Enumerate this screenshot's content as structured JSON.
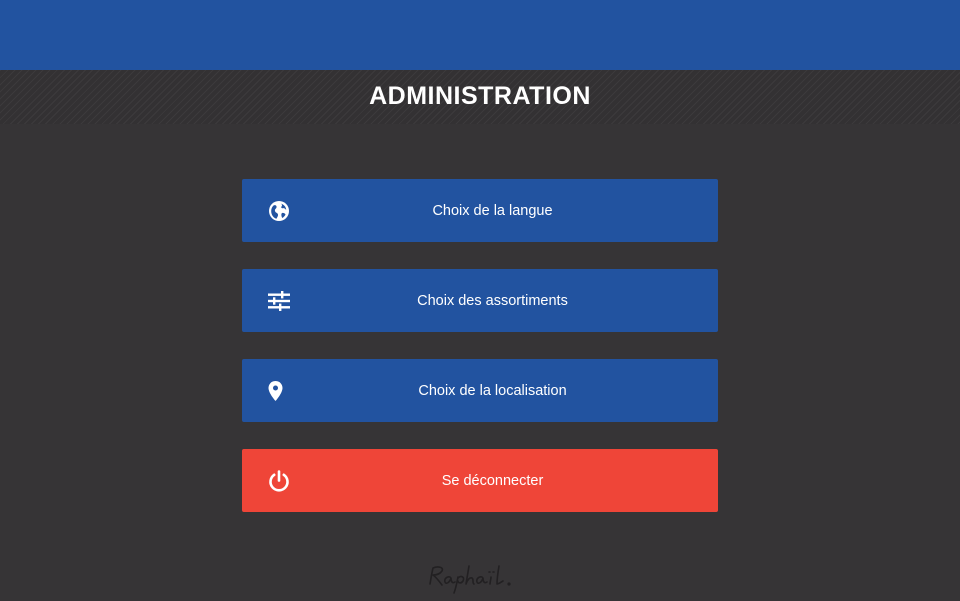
{
  "header": {
    "title": "ADMINISTRATION"
  },
  "menu": {
    "items": [
      {
        "label": "Choix de la langue",
        "icon": "globe-icon"
      },
      {
        "label": "Choix des assortiments",
        "icon": "sliders-icon"
      },
      {
        "label": "Choix de la localisation",
        "icon": "location-pin-icon"
      },
      {
        "label": "Se déconnecter",
        "icon": "power-icon"
      }
    ]
  },
  "brand": {
    "signature_text": "Raphaël"
  },
  "colors": {
    "primary_blue": "#2253a0",
    "danger_red": "#ef4538",
    "background": "#363436"
  }
}
